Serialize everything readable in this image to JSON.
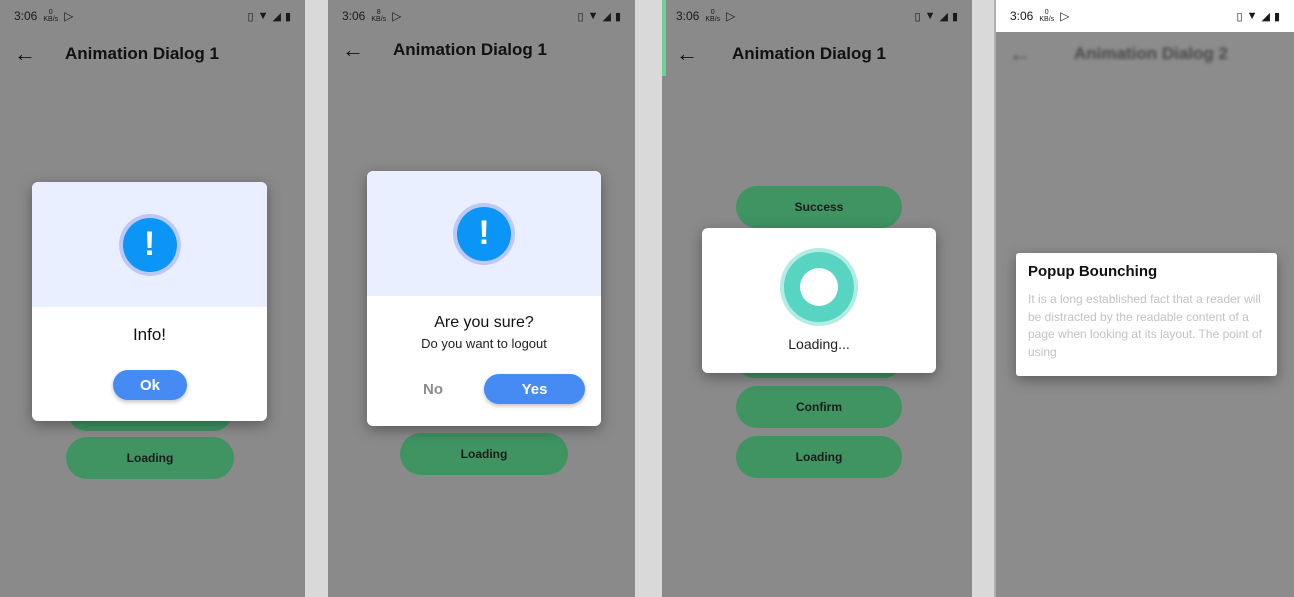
{
  "status_bar": {
    "time": "3:06",
    "speed_top": "0",
    "speed_top_alt": "8",
    "speed_unit": "KB/s"
  },
  "screens": [
    {
      "title": "Animation Dialog 1",
      "buttons": [
        "Loading"
      ],
      "dialog": {
        "title": "Info!",
        "ok_label": "Ok"
      }
    },
    {
      "title": "Animation Dialog 1",
      "buttons": [
        "Loading"
      ],
      "dialog": {
        "title": "Are you sure?",
        "message": "Do you want to logout",
        "no_label": "No",
        "yes_label": "Yes"
      }
    },
    {
      "title": "Animation Dialog 1",
      "buttons": [
        "Success",
        "Confirm",
        "Loading"
      ],
      "dialog": {
        "loading_label": "Loading..."
      }
    },
    {
      "title": "Animation Dialog 2",
      "dialog": {
        "title": "Popup Bounching",
        "body": "It is a long established fact that a reader will be distracted by the readable content of a page when looking at its layout. The point of using"
      }
    }
  ],
  "colors": {
    "scrim": "#8a8a8a",
    "green_button": "#3f9462",
    "blue_button": "#468af4",
    "alert_blue": "#0a95f7",
    "loader_teal": "#57d4c2"
  },
  "icons": [
    "back-arrow-icon",
    "alert-icon",
    "vibrate-icon",
    "wifi-icon",
    "signal-icon",
    "battery-icon",
    "play-store-icon"
  ]
}
